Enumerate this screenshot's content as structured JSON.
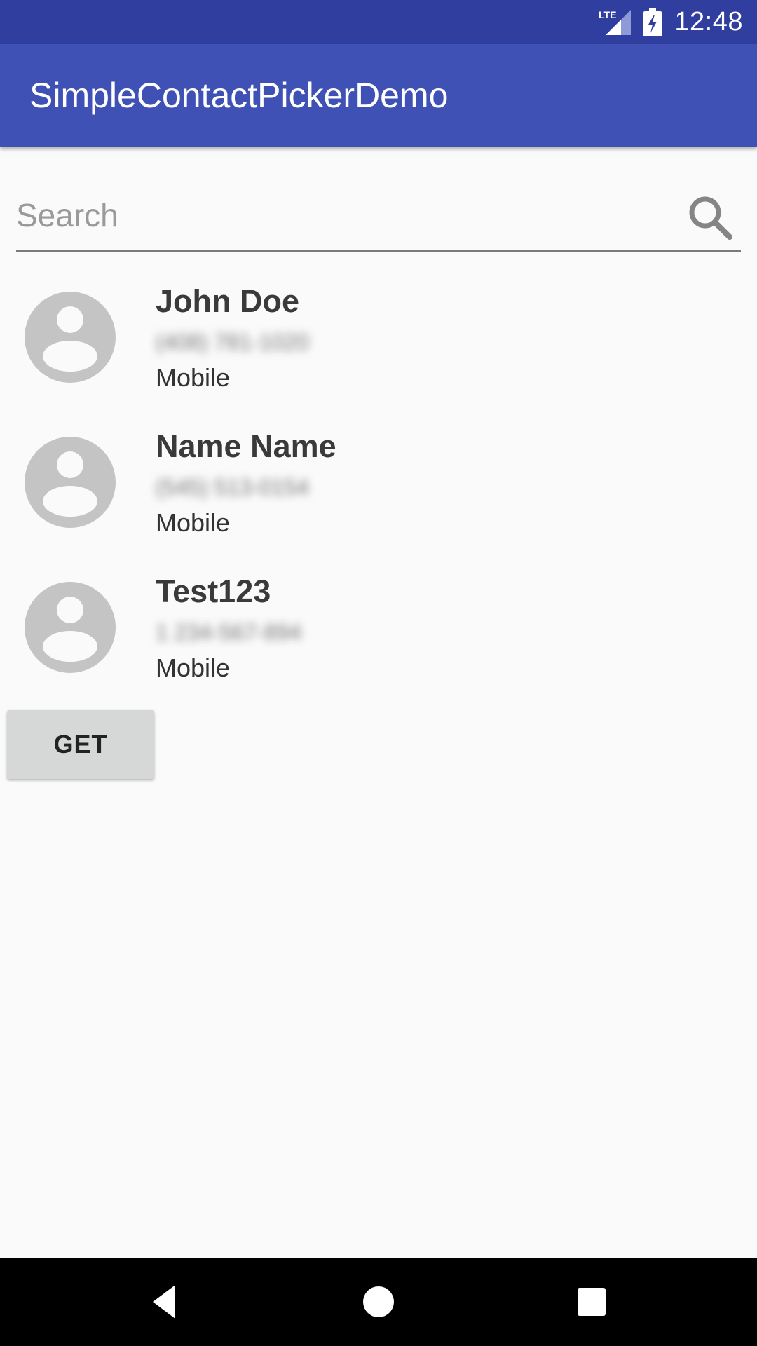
{
  "status_bar": {
    "network_label": "LTE",
    "time": "12:48",
    "icons": [
      "lte-signal-icon",
      "battery-charging-icon"
    ]
  },
  "app_bar": {
    "title": "SimpleContactPickerDemo",
    "background_color": "#3f51b5",
    "status_color": "#303f9f"
  },
  "search": {
    "placeholder": "Search",
    "value": ""
  },
  "contacts": [
    {
      "name": "John Doe",
      "phone": "(408) 781-1020",
      "type": "Mobile"
    },
    {
      "name": "Name Name",
      "phone": "(545) 513-0154",
      "type": "Mobile"
    },
    {
      "name": "Test123",
      "phone": "1 234-567-894",
      "type": "Mobile"
    }
  ],
  "actions": {
    "get_label": "GET"
  },
  "nav_bar": {
    "icons": [
      "back-icon",
      "home-icon",
      "recents-icon"
    ]
  }
}
